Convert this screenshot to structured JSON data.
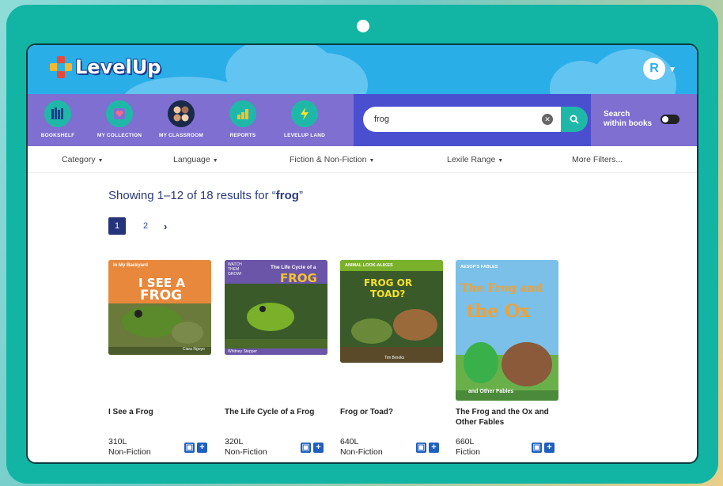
{
  "app": {
    "logo_text": "LevelUp",
    "avatar_initial": "R"
  },
  "nav": {
    "items": [
      {
        "label": "BOOKSHELF",
        "icon": "bookshelf-icon"
      },
      {
        "label": "MY COLLECTION",
        "icon": "collection-icon"
      },
      {
        "label": "MY CLASSROOM",
        "icon": "classroom-icon"
      },
      {
        "label": "REPORTS",
        "icon": "reports-icon"
      },
      {
        "label": "LEVELUP LAND",
        "icon": "levelup-land-icon"
      }
    ]
  },
  "search": {
    "value": "frog",
    "within_books_label_1": "Search",
    "within_books_label_2": "within books",
    "within_books_enabled": false
  },
  "filters": {
    "category": "Category",
    "language": "Language",
    "fiction": "Fiction & Non-Fiction",
    "lexile": "Lexile Range",
    "more": "More Filters..."
  },
  "results": {
    "prefix": "Showing 1–12 of 18 results for “",
    "query": "frog",
    "suffix": "”"
  },
  "pagination": {
    "pages": [
      "1",
      "2"
    ],
    "current": "1"
  },
  "books": [
    {
      "title": "I See a Frog",
      "lexile": "310L",
      "genre": "Non-Fiction",
      "cover": {
        "series": "In My Backyard",
        "line1": "I SEE A",
        "line2": "FROG",
        "author": "Ciara Ngoyo",
        "bg": "#e8883c"
      }
    },
    {
      "title": "The Life Cycle of a Frog",
      "lexile": "320L",
      "genre": "Non-Fiction",
      "cover": {
        "series": "WATCH THEM GROW!",
        "line1": "The Life Cycle of a",
        "line2": "FROG",
        "author": "Whitney Stepper",
        "bg": "#6a55a8"
      }
    },
    {
      "title": "Frog or Toad?",
      "lexile": "640L",
      "genre": "Non-Fiction",
      "cover": {
        "series": "ANIMAL LOOK-ALIKES",
        "line1": "FROG OR",
        "line2": "TOAD?",
        "author": "Tim Brooks",
        "bg": "#4a7a2a"
      }
    },
    {
      "title_line1": "The Frog and the Ox and",
      "title_line2": "Other Fables",
      "lexile": "660L",
      "genre": "Fiction",
      "cover": {
        "series": "AESOP'S FABLES",
        "line1": "The Frog and",
        "line2": "the Ox",
        "author": "and Other Fables",
        "bg": "#5aa8d8"
      }
    }
  ]
}
